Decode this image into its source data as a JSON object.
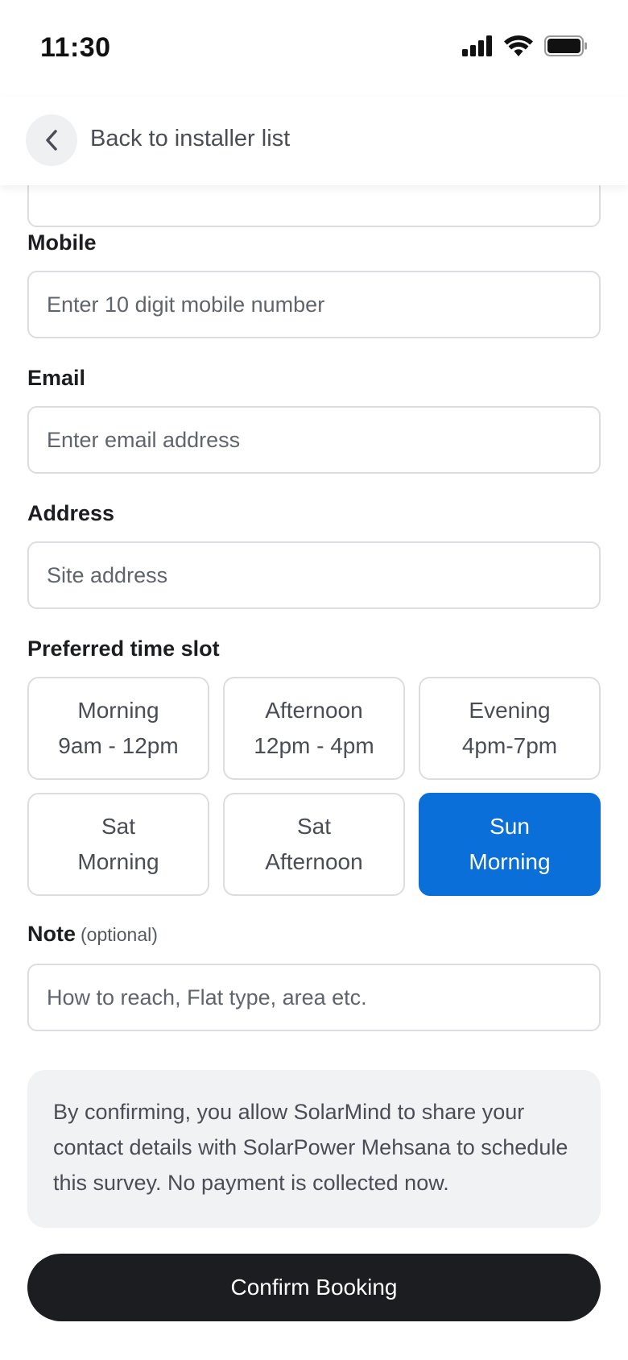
{
  "status_bar": {
    "time": "11:30",
    "icons": [
      "cellular-signal-icon",
      "wifi-icon",
      "battery-icon"
    ]
  },
  "header": {
    "back_icon": "chevron-left-icon",
    "back_label": "Back to installer list"
  },
  "form": {
    "mobile": {
      "label": "Mobile",
      "placeholder": "Enter 10 digit mobile number",
      "value": ""
    },
    "email": {
      "label": "Email",
      "placeholder": "Enter email address",
      "value": ""
    },
    "address": {
      "label": "Address",
      "placeholder": "Site address",
      "value": ""
    },
    "time_slot": {
      "label": "Preferred time slot",
      "slots": [
        {
          "line1": "Morning",
          "line2": "9am - 12pm",
          "selected": false
        },
        {
          "line1": "Afternoon",
          "line2": "12pm - 4pm",
          "selected": false
        },
        {
          "line1": "Evening",
          "line2": "4pm-7pm",
          "selected": false
        },
        {
          "line1": "Sat",
          "line2": "Morning",
          "selected": false
        },
        {
          "line1": "Sat",
          "line2": "Afternoon",
          "selected": false
        },
        {
          "line1": "Sun",
          "line2": "Morning",
          "selected": true
        }
      ]
    },
    "note": {
      "label": "Note",
      "optional_tag": "(optional)",
      "placeholder": "How to reach, Flat type, area etc.",
      "value": ""
    }
  },
  "consent_text": "By confirming, you allow SolarMind to share your contact details with SolarPower Mehsana to schedule this survey. No payment is collected now.",
  "confirm_button": "Confirm Booking",
  "colors": {
    "accent": "#0a6fd8",
    "primary_button": "#1c1d21",
    "consent_bg": "#f1f2f4",
    "border": "#dcdde1"
  }
}
